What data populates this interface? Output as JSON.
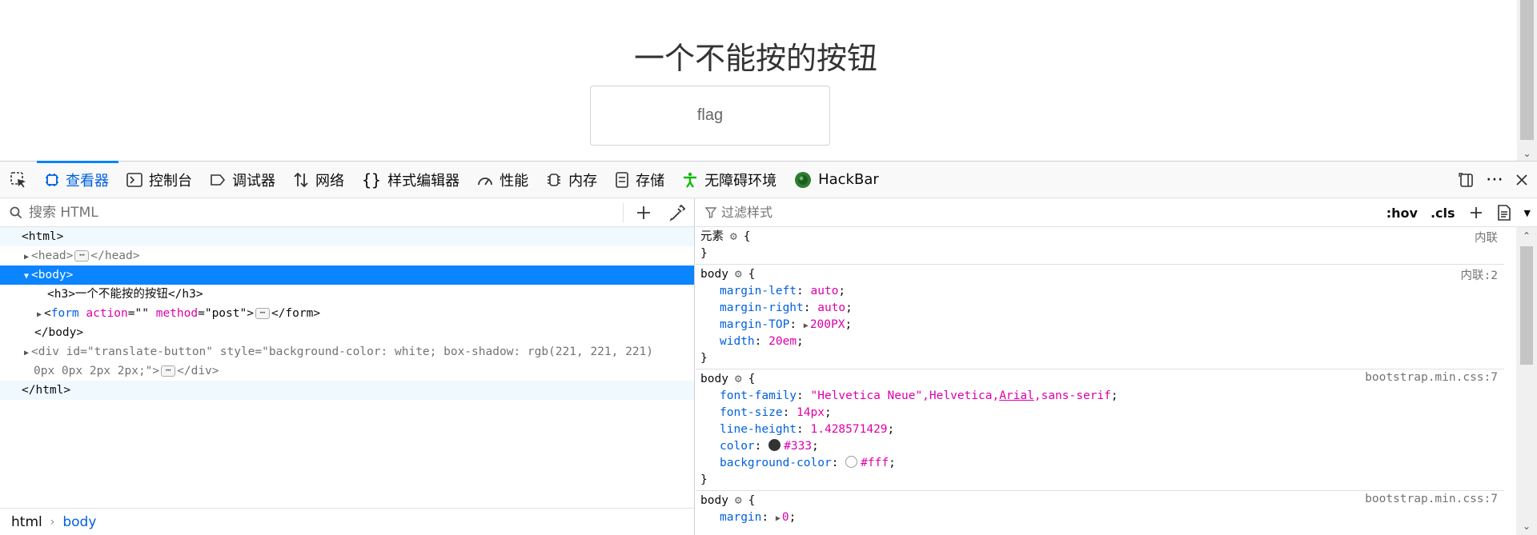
{
  "page": {
    "heading": "一个不能按的按钮",
    "button_label": "flag"
  },
  "devtools": {
    "tabs": [
      {
        "label": "查看器",
        "icon": "inspector-icon",
        "active": true
      },
      {
        "label": "控制台",
        "icon": "console-icon"
      },
      {
        "label": "调试器",
        "icon": "debugger-icon"
      },
      {
        "label": "网络",
        "icon": "network-icon"
      },
      {
        "label": "样式编辑器",
        "icon": "style-editor-icon"
      },
      {
        "label": "性能",
        "icon": "performance-icon"
      },
      {
        "label": "内存",
        "icon": "memory-icon"
      },
      {
        "label": "存储",
        "icon": "storage-icon"
      },
      {
        "label": "无障碍环境",
        "icon": "accessibility-icon"
      },
      {
        "label": "HackBar",
        "icon": "hackbar-icon"
      }
    ],
    "search_placeholder": "搜索 HTML",
    "filter_placeholder": "过滤样式",
    "hov_label": ":hov",
    "cls_label": ".cls",
    "markup": {
      "html_open": "<html>",
      "head_open": "<head>",
      "head_close": "</head>",
      "body_open": "<body>",
      "h3_open": "<h3>",
      "h3_text": "一个不能按的按钮",
      "h3_close": "</h3>",
      "form_tag": "form",
      "form_attr1_name": "action",
      "form_attr1_val": "\"\"",
      "form_attr2_name": "method",
      "form_attr2_val": "\"post\"",
      "form_close": "</form>",
      "body_close": "</body>",
      "div_tag": "div",
      "div_attr1_name": "id",
      "div_attr1_val": "\"translate-button\"",
      "div_attr2_name": "style",
      "div_attr2_val_line1": "\"background-color: white; box-shadow: rgb(221, 221, 221)",
      "div_attr2_val_line2": "0px 0px 2px 2px;\"",
      "div_close": "</div>",
      "html_close": "</html>"
    },
    "breadcrumb": [
      "html",
      "body"
    ],
    "rules": [
      {
        "selector": "元素",
        "source": "内联",
        "decls": []
      },
      {
        "selector": "body",
        "source": "内联:2",
        "decls": [
          {
            "prop": "margin-left",
            "val": "auto"
          },
          {
            "prop": "margin-right",
            "val": "auto"
          },
          {
            "prop": "margin-TOP",
            "val": "200PX",
            "expand": true
          },
          {
            "prop": "width",
            "val": "20em"
          }
        ]
      },
      {
        "selector": "body",
        "source": "bootstrap.min.css:7",
        "decls": [
          {
            "prop": "font-family",
            "val_parts": [
              "\"Helvetica Neue\",Helvetica,",
              "Arial",
              ",sans-serif"
            ]
          },
          {
            "prop": "font-size",
            "val": "14px"
          },
          {
            "prop": "line-height",
            "val": "1.428571429"
          },
          {
            "prop": "color",
            "val": "#333",
            "swatch": "#333333"
          },
          {
            "prop": "background-color",
            "val": "#fff",
            "swatch": "#ffffff"
          }
        ]
      },
      {
        "selector": "body",
        "source": "bootstrap.min.css:7",
        "decls": [
          {
            "prop": "margin",
            "val": "0",
            "expand": true
          }
        ]
      }
    ],
    "colors": {
      "accent": "#0a84ff",
      "tag_name": "#0060df",
      "attr_name": "#dd00a9"
    }
  }
}
